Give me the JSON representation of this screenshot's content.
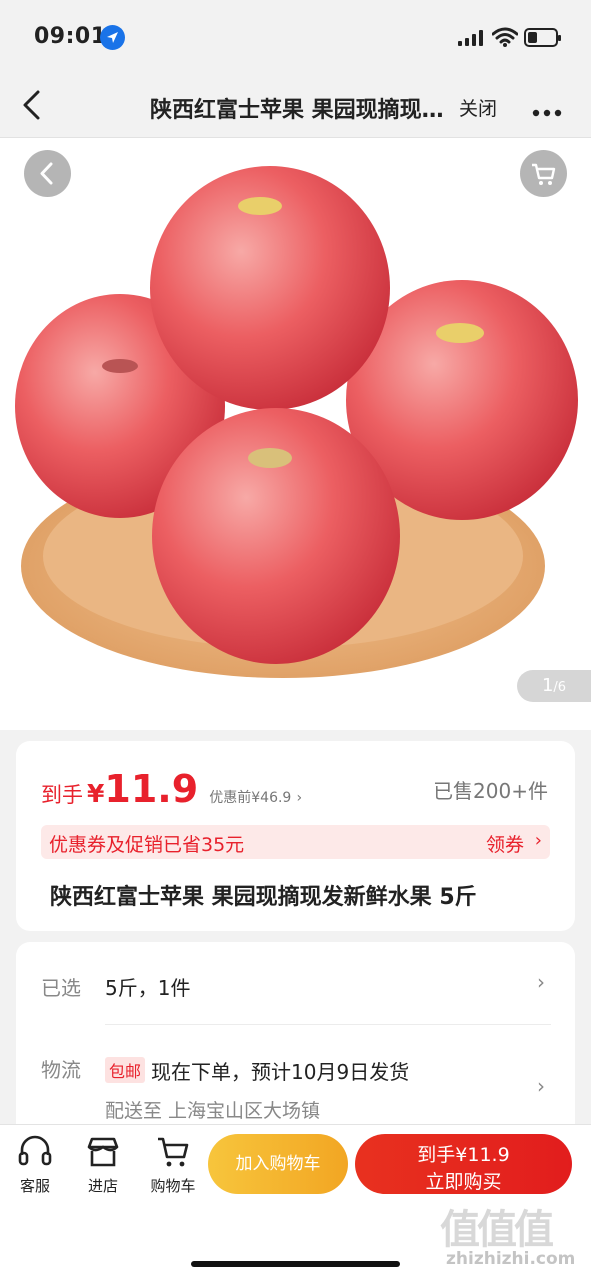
{
  "status_bar": {
    "time": "09:01"
  },
  "nav": {
    "title": "陕西红富士苹果 果园现摘现发新鲜水果 5斤",
    "close_label": "关闭"
  },
  "gallery": {
    "page_current": "1",
    "page_total": "/6"
  },
  "price": {
    "label": "到手",
    "currency": "¥",
    "amount": "11.9",
    "original": "优惠前¥46.9",
    "sold": "已售200+件"
  },
  "promo": {
    "text": "优惠券及促销已省35元",
    "action": "领券"
  },
  "product": {
    "title": "陕西红富士苹果 果园现摘现发新鲜水果 5斤"
  },
  "options": {
    "selected_label": "已选",
    "selected_value": "5斤，1件",
    "logistics_label": "物流",
    "free_badge": "包邮",
    "ship_text": "现在下单，预计10月9日发货",
    "address": "配送至 上海宝山区大场镇"
  },
  "bottom": {
    "service": "客服",
    "store": "进店",
    "cart": "购物车",
    "add_cart": "加入购物车",
    "buy_line1": "到手¥11.9",
    "buy_line2": "立即购买"
  },
  "watermark": {
    "text": "zhizhizhi.com",
    "logo": "值值值"
  },
  "colors": {
    "accent": "#e8212c",
    "cart_button": "#f2a623",
    "buy_button": "#e21d1d"
  }
}
